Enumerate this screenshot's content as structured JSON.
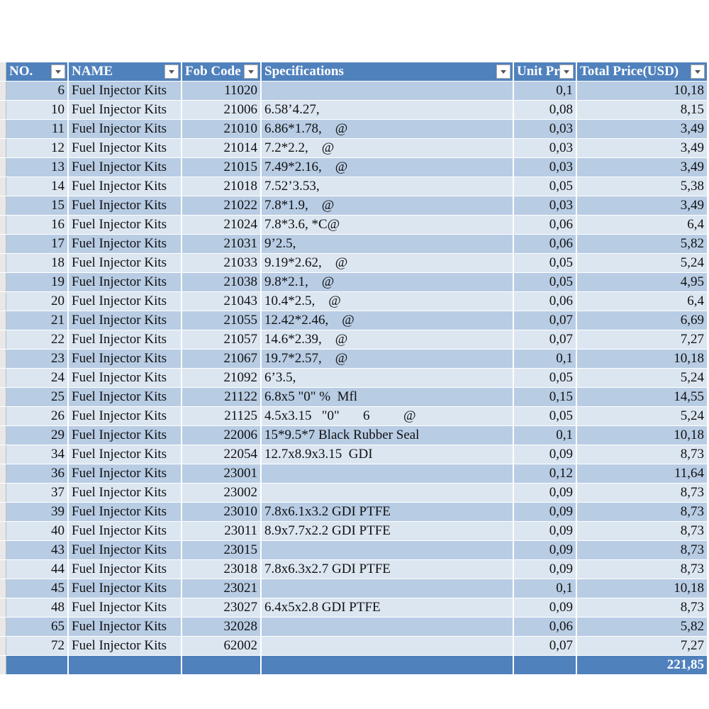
{
  "headers": [
    "NO.",
    "NAME",
    "Fob Code",
    "Specifications",
    "Unit Pr",
    "Total Price(USD)"
  ],
  "rows": [
    [
      "6",
      "Fuel Injector Kits",
      "11020",
      "",
      "0,1",
      "10,18"
    ],
    [
      "10",
      "Fuel Injector Kits",
      "21006",
      "6.58’4.27,",
      "0,08",
      "8,15"
    ],
    [
      "11",
      "Fuel Injector Kits",
      "21010",
      "6.86*1.78,    @",
      "0,03",
      "3,49"
    ],
    [
      "12",
      "Fuel Injector Kits",
      "21014",
      "7.2*2.2,    @",
      "0,03",
      "3,49"
    ],
    [
      "13",
      "Fuel Injector Kits",
      "21015",
      "7.49*2.16,    @",
      "0,03",
      "3,49"
    ],
    [
      "14",
      "Fuel Injector Kits",
      "21018",
      "7.52’3.53,",
      "0,05",
      "5,38"
    ],
    [
      "15",
      "Fuel Injector Kits",
      "21022",
      "7.8*1.9,    @",
      "0,03",
      "3,49"
    ],
    [
      "16",
      "Fuel Injector Kits",
      "21024",
      "7.8*3.6, *C@",
      "0,06",
      "6,4"
    ],
    [
      "17",
      "Fuel Injector Kits",
      "21031",
      "9’2.5,",
      "0,06",
      "5,82"
    ],
    [
      "18",
      "Fuel Injector Kits",
      "21033",
      "9.19*2.62,    @",
      "0,05",
      "5,24"
    ],
    [
      "19",
      "Fuel Injector Kits",
      "21038",
      "9.8*2.1,    @",
      "0,05",
      "4,95"
    ],
    [
      "20",
      "Fuel Injector Kits",
      "21043",
      "10.4*2.5,    @",
      "0,06",
      "6,4"
    ],
    [
      "21",
      "Fuel Injector Kits",
      "21055",
      "12.42*2.46,    @",
      "0,07",
      "6,69"
    ],
    [
      "22",
      "Fuel Injector Kits",
      "21057",
      "14.6*2.39,    @",
      "0,07",
      "7,27"
    ],
    [
      "23",
      "Fuel Injector Kits",
      "21067",
      "19.7*2.57,    @",
      "0,1",
      "10,18"
    ],
    [
      "24",
      "Fuel Injector Kits",
      "21092",
      "6’3.5,",
      "0,05",
      "5,24"
    ],
    [
      "25",
      "Fuel Injector Kits",
      "21122",
      "6.8x5 \"0\" %  Mfl",
      "0,15",
      "14,55"
    ],
    [
      "26",
      "Fuel Injector Kits",
      "21125",
      "4.5x3.15   \"0\"       6          @",
      "0,05",
      "5,24"
    ],
    [
      "29",
      "Fuel Injector Kits",
      "22006",
      "15*9.5*7 Black Rubber Seal",
      "0,1",
      "10,18"
    ],
    [
      "34",
      "Fuel Injector Kits",
      "22054",
      "12.7x8.9x3.15  GDI",
      "0,09",
      "8,73"
    ],
    [
      "36",
      "Fuel Injector Kits",
      "23001",
      "",
      "0,12",
      "11,64"
    ],
    [
      "37",
      "Fuel Injector Kits",
      "23002",
      "",
      "0,09",
      "8,73"
    ],
    [
      "39",
      "Fuel Injector Kits",
      "23010",
      "7.8x6.1x3.2 GDI PTFE",
      "0,09",
      "8,73"
    ],
    [
      "40",
      "Fuel Injector Kits",
      "23011",
      "8.9x7.7x2.2 GDI PTFE",
      "0,09",
      "8,73"
    ],
    [
      "43",
      "Fuel Injector Kits",
      "23015",
      "",
      "0,09",
      "8,73"
    ],
    [
      "44",
      "Fuel Injector Kits",
      "23018",
      "7.8x6.3x2.7 GDI PTFE",
      "0,09",
      "8,73"
    ],
    [
      "45",
      "Fuel Injector Kits",
      "23021",
      "",
      "0,1",
      "10,18"
    ],
    [
      "48",
      "Fuel Injector Kits",
      "23027",
      "6.4x5x2.8 GDI PTFE",
      "0,09",
      "8,73"
    ],
    [
      "65",
      "Fuel Injector Kits",
      "32028",
      "",
      "0,06",
      "5,82"
    ],
    [
      "72",
      "Fuel Injector Kits",
      "62002",
      "",
      "0,07",
      "7,27"
    ]
  ],
  "total": "221,85"
}
